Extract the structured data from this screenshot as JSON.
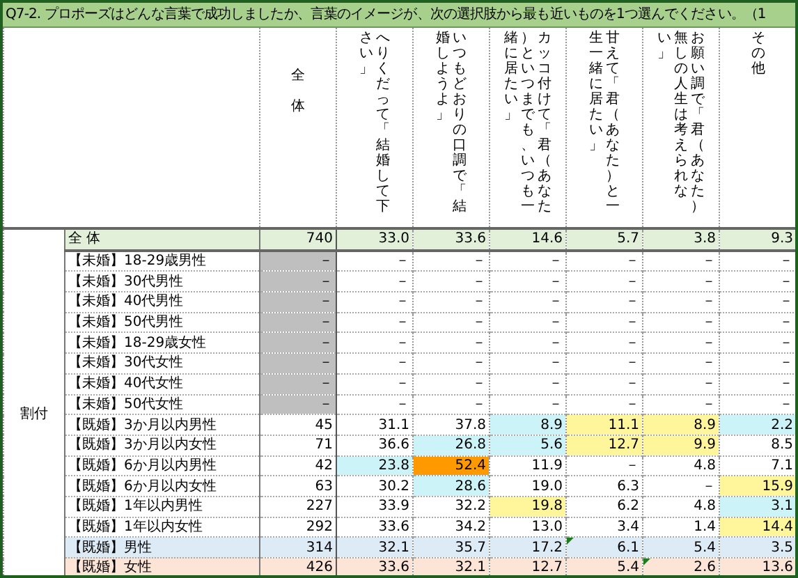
{
  "title": "Q7-2. プロポーズはどんな言葉で成功しましたか、言葉のイメージが、次の選択肢から最も近いものを1つ選んでください。（1",
  "header": {
    "total": "全体",
    "columns": [
      "へりくだって「結婚して下さい」",
      "いつもどおりの口調で「結婚しようよ」",
      "カッコ付けて「君（あなた）といつまでも、いつも一緒に居たい」",
      "甘えて「君（あなた）と一生一緒に居たい」",
      "お願い調で「君（あなた）無しの人生は考えられない」",
      "その他"
    ]
  },
  "group_label": "割付",
  "rows": [
    {
      "kind": "total",
      "label": "全 体",
      "cells": [
        {
          "value": "740"
        },
        {
          "value": "33.0"
        },
        {
          "value": "33.6"
        },
        {
          "value": "14.6"
        },
        {
          "value": "5.7"
        },
        {
          "value": "3.8"
        },
        {
          "value": "9.3"
        }
      ]
    },
    {
      "kind": "normal",
      "label": "【未婚】18-29歳男性",
      "cells": [
        {
          "value": "－",
          "color": "#bfbfbf"
        },
        {
          "value": "－"
        },
        {
          "value": "－"
        },
        {
          "value": "－"
        },
        {
          "value": "－"
        },
        {
          "value": "－"
        },
        {
          "value": "－"
        }
      ]
    },
    {
      "kind": "normal",
      "label": "【未婚】30代男性",
      "cells": [
        {
          "value": "－",
          "color": "#bfbfbf"
        },
        {
          "value": "－"
        },
        {
          "value": "－"
        },
        {
          "value": "－"
        },
        {
          "value": "－"
        },
        {
          "value": "－"
        },
        {
          "value": "－"
        }
      ]
    },
    {
      "kind": "normal",
      "label": "【未婚】40代男性",
      "cells": [
        {
          "value": "－",
          "color": "#bfbfbf"
        },
        {
          "value": "－"
        },
        {
          "value": "－"
        },
        {
          "value": "－"
        },
        {
          "value": "－"
        },
        {
          "value": "－"
        },
        {
          "value": "－"
        }
      ]
    },
    {
      "kind": "normal",
      "label": "【未婚】50代男性",
      "cells": [
        {
          "value": "－",
          "color": "#bfbfbf"
        },
        {
          "value": "－"
        },
        {
          "value": "－"
        },
        {
          "value": "－"
        },
        {
          "value": "－"
        },
        {
          "value": "－"
        },
        {
          "value": "－"
        }
      ]
    },
    {
      "kind": "normal",
      "label": "【未婚】18-29歳女性",
      "cells": [
        {
          "value": "－",
          "color": "#bfbfbf"
        },
        {
          "value": "－"
        },
        {
          "value": "－"
        },
        {
          "value": "－"
        },
        {
          "value": "－"
        },
        {
          "value": "－"
        },
        {
          "value": "－"
        }
      ]
    },
    {
      "kind": "normal",
      "label": "【未婚】30代女性",
      "cells": [
        {
          "value": "－",
          "color": "#bfbfbf"
        },
        {
          "value": "－"
        },
        {
          "value": "－"
        },
        {
          "value": "－"
        },
        {
          "value": "－"
        },
        {
          "value": "－"
        },
        {
          "value": "－"
        }
      ]
    },
    {
      "kind": "normal",
      "label": "【未婚】40代女性",
      "cells": [
        {
          "value": "－",
          "color": "#bfbfbf"
        },
        {
          "value": "－"
        },
        {
          "value": "－"
        },
        {
          "value": "－"
        },
        {
          "value": "－"
        },
        {
          "value": "－"
        },
        {
          "value": "－"
        }
      ]
    },
    {
      "kind": "normal",
      "label": "【未婚】50代女性",
      "cells": [
        {
          "value": "－",
          "color": "#bfbfbf"
        },
        {
          "value": "－"
        },
        {
          "value": "－"
        },
        {
          "value": "－"
        },
        {
          "value": "－"
        },
        {
          "value": "－"
        },
        {
          "value": "－"
        }
      ]
    },
    {
      "kind": "normal",
      "label": "【既婚】3か月以内男性",
      "cells": [
        {
          "value": "45"
        },
        {
          "value": "31.1"
        },
        {
          "value": "37.8"
        },
        {
          "value": "8.9",
          "color": "#ccf4f8"
        },
        {
          "value": "11.1",
          "color": "#fff69c"
        },
        {
          "value": "8.9",
          "color": "#fff69c"
        },
        {
          "value": "2.2",
          "color": "#ccf4f8"
        }
      ]
    },
    {
      "kind": "normal",
      "label": "【既婚】3か月以内女性",
      "cells": [
        {
          "value": "71"
        },
        {
          "value": "36.6"
        },
        {
          "value": "26.8",
          "color": "#ccf4f8"
        },
        {
          "value": "5.6",
          "color": "#ccf4f8"
        },
        {
          "value": "12.7",
          "color": "#fff69c"
        },
        {
          "value": "9.9",
          "color": "#fff69c"
        },
        {
          "value": "8.5"
        }
      ]
    },
    {
      "kind": "normal",
      "label": "【既婚】6か月以内男性",
      "cells": [
        {
          "value": "42"
        },
        {
          "value": "23.8",
          "color": "#ccf4f8"
        },
        {
          "value": "52.4",
          "color": "#ff9900"
        },
        {
          "value": "11.9"
        },
        {
          "value": "－"
        },
        {
          "value": "4.8"
        },
        {
          "value": "7.1"
        }
      ]
    },
    {
      "kind": "normal",
      "label": "【既婚】6か月以内女性",
      "cells": [
        {
          "value": "63"
        },
        {
          "value": "30.2"
        },
        {
          "value": "28.6",
          "color": "#ccf4f8"
        },
        {
          "value": "19.0"
        },
        {
          "value": "6.3"
        },
        {
          "value": "－"
        },
        {
          "value": "15.9",
          "color": "#fff69c"
        }
      ]
    },
    {
      "kind": "normal",
      "label": "【既婚】1年以内男性",
      "cells": [
        {
          "value": "227"
        },
        {
          "value": "33.9"
        },
        {
          "value": "32.2"
        },
        {
          "value": "19.8",
          "color": "#fff69c"
        },
        {
          "value": "6.2"
        },
        {
          "value": "4.8"
        },
        {
          "value": "3.1",
          "color": "#ccf4f8"
        }
      ]
    },
    {
      "kind": "normal",
      "label": "【既婚】1年以内女性",
      "cells": [
        {
          "value": "292"
        },
        {
          "value": "33.6"
        },
        {
          "value": "34.2"
        },
        {
          "value": "13.0"
        },
        {
          "value": "3.4"
        },
        {
          "value": "1.4"
        },
        {
          "value": "14.4",
          "color": "#fff69c"
        }
      ]
    },
    {
      "kind": "male",
      "label": "【既婚】男性",
      "cells": [
        {
          "value": "314"
        },
        {
          "value": "32.1"
        },
        {
          "value": "35.7"
        },
        {
          "value": "17.2"
        },
        {
          "value": "6.1",
          "flag": true
        },
        {
          "value": "5.4"
        },
        {
          "value": "3.5"
        }
      ]
    },
    {
      "kind": "female",
      "label": "【既婚】女性",
      "cells": [
        {
          "value": "426"
        },
        {
          "value": "33.6"
        },
        {
          "value": "32.1"
        },
        {
          "value": "12.7"
        },
        {
          "value": "5.4"
        },
        {
          "value": "2.6",
          "flag": true
        },
        {
          "value": "13.6"
        }
      ]
    }
  ]
}
